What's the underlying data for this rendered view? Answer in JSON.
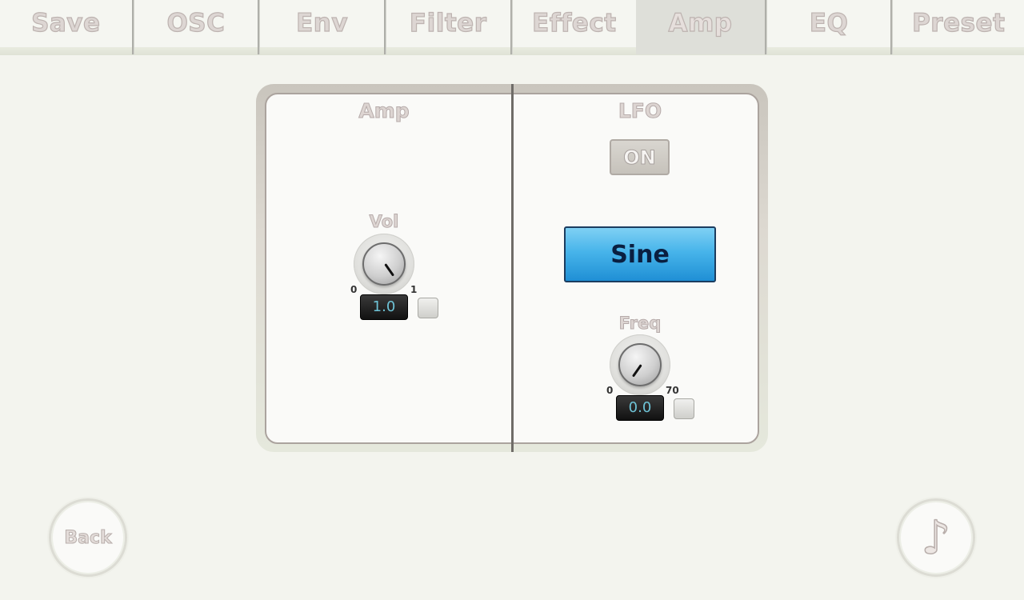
{
  "tabs": [
    {
      "label": "Save",
      "active": false
    },
    {
      "label": "OSC",
      "active": false
    },
    {
      "label": "Env",
      "active": false
    },
    {
      "label": "Filter",
      "active": false
    },
    {
      "label": "Effect",
      "active": false
    },
    {
      "label": "Amp",
      "active": true
    },
    {
      "label": "EQ",
      "active": false
    },
    {
      "label": "Preset",
      "active": false
    }
  ],
  "amp": {
    "title": "Amp",
    "vol": {
      "label": "Vol",
      "min": "0",
      "max": "1",
      "value": "1.0"
    }
  },
  "lfo": {
    "title": "LFO",
    "toggle_label": "ON",
    "waveform": "Sine",
    "freq": {
      "label": "Freq",
      "min": "0",
      "max": "70",
      "value": "0.0"
    }
  },
  "nav": {
    "back_label": "Back",
    "note_icon": "♪"
  },
  "colors": {
    "background": "#f3f4ee",
    "wave_button": "#47b4ea",
    "value_text": "#6ec3d6"
  },
  "icons": {
    "note": "music-note-icon"
  }
}
